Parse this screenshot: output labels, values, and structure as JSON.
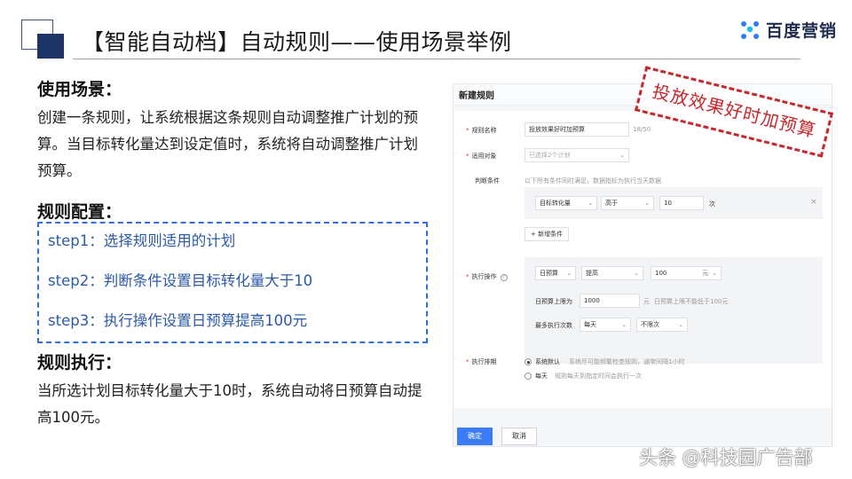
{
  "header": {
    "title": "【智能自动档】自动规则——使用场景举例",
    "brand": "百度营销"
  },
  "scene": {
    "heading": "使用场景：",
    "body": "创建一条规则，让系统根据这条规则自动调整推广计划的预算。当目标转化量达到设定值时，系统将自动调整推广计划预算。"
  },
  "config": {
    "heading": "规则配置：",
    "steps": [
      "step1：选择规则适用的计划",
      "step2：判断条件设置目标转化量大于10",
      "step3：执行操作设置日预算提高100元"
    ]
  },
  "execution": {
    "heading": "规则执行：",
    "body": "当所选计划目标转化量大于10时，系统自动将日预算自动提高100元。"
  },
  "panel": {
    "title": "新建规则",
    "rule_name_label": "规则名称",
    "rule_name_value": "投放效果好时加预算",
    "rule_name_count": "18/50",
    "target_label": "适用对象",
    "target_placeholder": "已选择2个计划",
    "condition_label": "判断条件",
    "condition_hint": "以下所有条件同时满足，数据指标为执行当天数据",
    "condition_metric": "目标转化量",
    "condition_operator": "高于",
    "condition_value": "10",
    "condition_unit": "次",
    "condition_remove": "×",
    "add_condition": "+ 新增条件",
    "action_label": "执行操作",
    "action_field": "日预算",
    "action_mode": "提高",
    "action_amount": "100",
    "action_amount_unit": "元",
    "budget_cap_label": "日预算上限为",
    "budget_cap_value": "1000",
    "budget_cap_unit": "元",
    "budget_cap_hint": "日预算上限不能低于100元",
    "max_exec_label": "最多执行次数",
    "max_exec_period": "每天",
    "max_exec_limit": "不限次",
    "schedule_label": "执行排期",
    "schedule_default": "系统默认",
    "schedule_default_hint": "系统尽可能频繁检查规则，通常间隔1小时",
    "schedule_daily": "每天",
    "schedule_daily_hint": "规则每天到指定时间会执行一次",
    "confirm": "确定",
    "cancel": "取消"
  },
  "stamp": "投放效果好时加预算",
  "watermark": "头条 @科技园广告部",
  "colors": {
    "accent_blue": "#2f6fd6",
    "navy": "#1c3466",
    "stamp_red": "#c8272c",
    "button_blue": "#3b7cf6"
  }
}
